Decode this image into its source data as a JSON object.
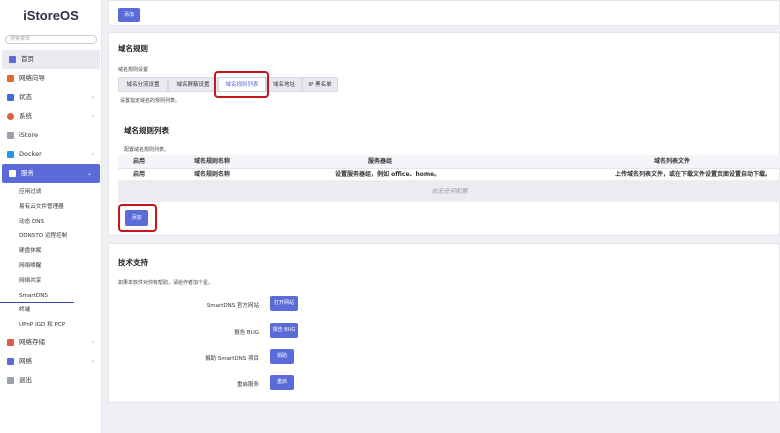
{
  "brand": "iStoreOS",
  "search_placeholder": "搜索菜单",
  "nav": {
    "home": "首页",
    "wizard": "网络向导",
    "status": "状态",
    "system": "系统",
    "istore": "iStore",
    "docker": "Docker",
    "services": "服务",
    "storage": "网络存储",
    "network": "网络",
    "logout": "退出"
  },
  "services_sub": [
    "应用过滤",
    "易有云文件管理器",
    "动态 DNS",
    "DDNSTO 远程控制",
    "硬盘休眠",
    "网络唤醒",
    "网络共享",
    "SmartDNS",
    "终端",
    "UPnP IGD 和 PCP"
  ],
  "top_add": "添加",
  "domain_rules": {
    "title": "域名规则",
    "settings_label": "域名规则设置",
    "tabs": [
      "域名分流设置",
      "域名屏蔽设置",
      "域名规则列表",
      "域名地址",
      "IP 黑名单"
    ],
    "tab_desc": "设置指定域名的规则列表。",
    "list_title": "域名规则列表",
    "list_desc": "配置域名规则列表。",
    "columns": [
      "启用",
      "域名规则名称",
      "服务器组",
      "域名列表文件"
    ],
    "row": [
      "启用",
      "域名规则名称",
      "设置服务器组，例如 office、home。",
      "上传域名列表文件，或在下载文件设置页面设置自动下载。"
    ],
    "empty": "尚无任何配置",
    "add": "添加"
  },
  "support": {
    "title": "技术支持",
    "desc": "如果本软件对你有帮助，请给作者加个星。",
    "rows": [
      {
        "label": "SmartDNS 官方网站",
        "button": "打开网站"
      },
      {
        "label": "报告 BUG",
        "button": "报告 BUG"
      },
      {
        "label": "捐助 SmartDNS 项目",
        "button": "捐助"
      },
      {
        "label": "重启服务",
        "button": "重启"
      }
    ]
  },
  "colors": {
    "accent": "#5b6bd7",
    "highlight": "#c8141c"
  }
}
